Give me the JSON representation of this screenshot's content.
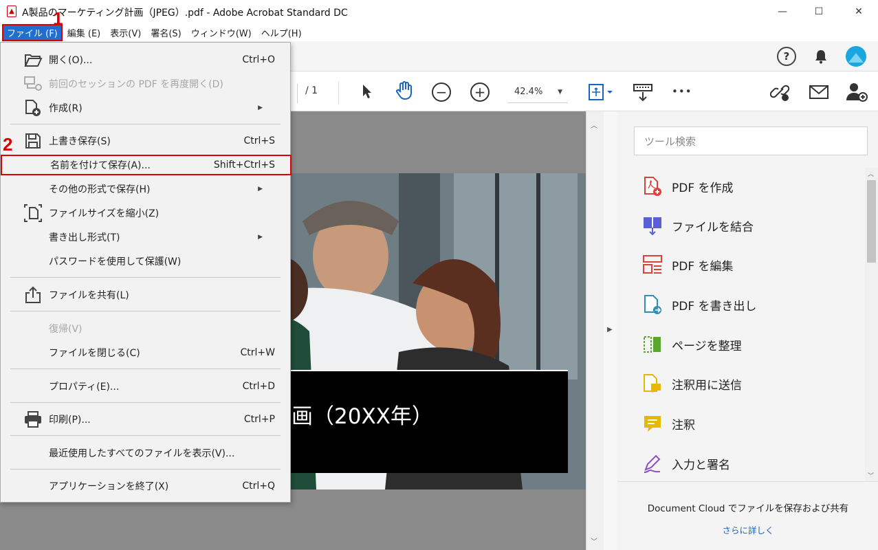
{
  "window": {
    "title": "A製品のマーケティング計画（JPEG）.pdf - Adobe Acrobat Standard DC",
    "minimize_glyph": "—",
    "maximize_glyph": "☐",
    "close_glyph": "✕"
  },
  "menubar": {
    "items": [
      {
        "label": "ファイル (F)"
      },
      {
        "label": "編集 (E)"
      },
      {
        "label": "表示(V)"
      },
      {
        "label": "署名(S)"
      },
      {
        "label": "ウィンドウ(W)"
      },
      {
        "label": "ヘルプ(H)"
      }
    ]
  },
  "steps": {
    "one": "1",
    "two": "2"
  },
  "toolbar": {
    "page_total": "/ 1",
    "zoom": "42.4%",
    "more_glyph": "•••"
  },
  "file_menu": {
    "items": [
      {
        "label": "開く(O)...",
        "shortcut": "Ctrl+O",
        "icon": "open-folder-icon",
        "enabled": true
      },
      {
        "label": "前回のセッションの PDF を再度開く(D)",
        "shortcut": "",
        "icon": "reopen-session-icon",
        "enabled": false
      },
      {
        "label": "作成(R)",
        "shortcut": "",
        "icon": "create-pdf-icon",
        "enabled": true,
        "submenu": true
      },
      {
        "label": "上書き保存(S)",
        "shortcut": "Ctrl+S",
        "icon": "save-disk-icon",
        "enabled": true
      },
      {
        "label": "名前を付けて保存(A)...",
        "shortcut": "Shift+Ctrl+S",
        "icon": "",
        "enabled": true,
        "highlighted": true
      },
      {
        "label": "その他の形式で保存(H)",
        "shortcut": "",
        "icon": "",
        "enabled": true,
        "submenu": true
      },
      {
        "label": "ファイルサイズを縮小(Z)",
        "shortcut": "",
        "icon": "reduce-size-icon",
        "enabled": true
      },
      {
        "label": "書き出し形式(T)",
        "shortcut": "",
        "icon": "",
        "enabled": true,
        "submenu": true
      },
      {
        "label": "パスワードを使用して保護(W)",
        "shortcut": "",
        "icon": "",
        "enabled": true
      },
      {
        "label": "ファイルを共有(L)",
        "shortcut": "",
        "icon": "share-icon",
        "enabled": true
      },
      {
        "label": "復帰(V)",
        "shortcut": "",
        "icon": "",
        "enabled": false
      },
      {
        "label": "ファイルを閉じる(C)",
        "shortcut": "Ctrl+W",
        "icon": "",
        "enabled": true
      },
      {
        "label": "プロパティ(E)...",
        "shortcut": "Ctrl+D",
        "icon": "",
        "enabled": true
      },
      {
        "label": "印刷(P)...",
        "shortcut": "Ctrl+P",
        "icon": "printer-icon",
        "enabled": true
      },
      {
        "label": "最近使用したすべてのファイルを表示(V)...",
        "shortcut": "",
        "icon": "",
        "enabled": true
      },
      {
        "label": "アプリケーションを終了(X)",
        "shortcut": "Ctrl+Q",
        "icon": "",
        "enabled": true
      }
    ],
    "submenu_glyph": "▶"
  },
  "document": {
    "title_fragment": "画（20XX年）"
  },
  "right_pane": {
    "search_placeholder": "ツール検索",
    "tools": [
      {
        "label": "PDF を作成",
        "icon": "create-pdf-tool-icon",
        "color": "#e0403a"
      },
      {
        "label": "ファイルを結合",
        "icon": "combine-files-icon",
        "color": "#5b5fd6"
      },
      {
        "label": "PDF を編集",
        "icon": "edit-pdf-icon",
        "color": "#e0403a"
      },
      {
        "label": "PDF を書き出し",
        "icon": "export-pdf-icon",
        "color": "#2f8fb3"
      },
      {
        "label": "ページを整理",
        "icon": "organize-pages-icon",
        "color": "#5aa52d"
      },
      {
        "label": "注釈用に送信",
        "icon": "send-for-comments-icon",
        "color": "#e6b800"
      },
      {
        "label": "注釈",
        "icon": "comment-icon",
        "color": "#e6b800"
      },
      {
        "label": "入力と署名",
        "icon": "fill-sign-icon",
        "color": "#8a4fc7"
      }
    ],
    "cloud_text": "Document Cloud でファイルを保存および共有",
    "cloud_link": "さらに詳しく"
  }
}
